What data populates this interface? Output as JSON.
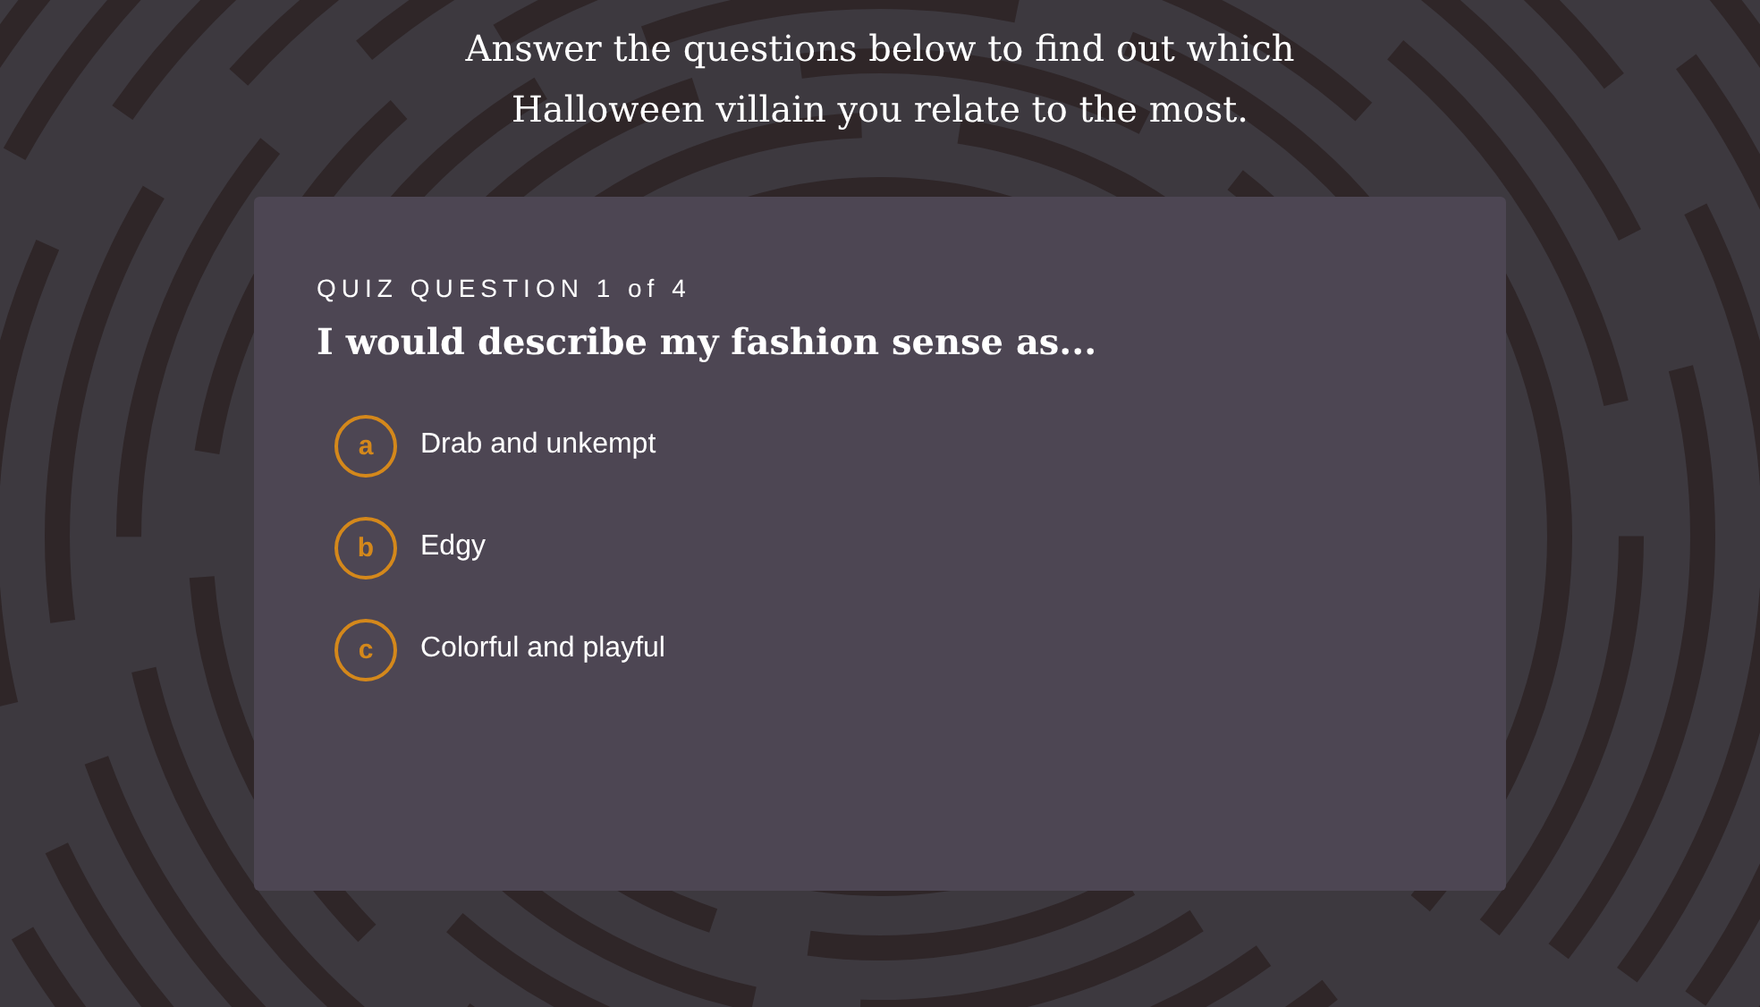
{
  "intro": {
    "lines": [
      "Answer the questions below to find out which",
      "Halloween villain you relate to the most."
    ]
  },
  "quiz": {
    "counter": "QUIZ QUESTION 1 of 4",
    "question": "I would describe my fashion sense as...",
    "options": [
      {
        "letter": "a",
        "label": "Drab and unkempt"
      },
      {
        "letter": "b",
        "label": "Edgy"
      },
      {
        "letter": "c",
        "label": "Colorful and playful"
      }
    ]
  }
}
